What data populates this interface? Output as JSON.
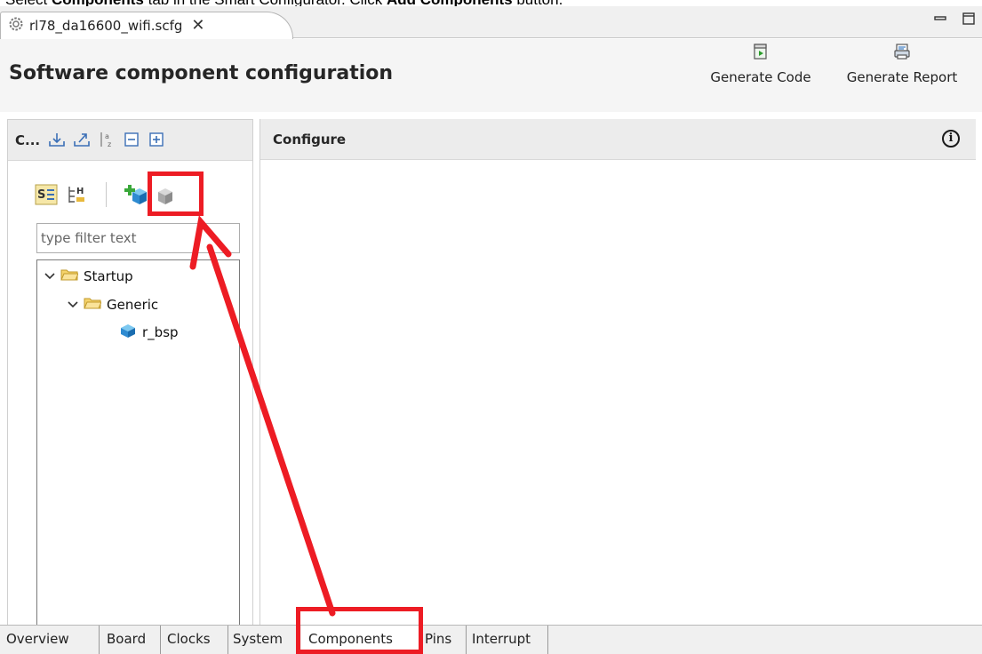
{
  "instruction": {
    "prefix": "Select ",
    "bold1": "Components",
    "mid": " tab in the Smart Configurator. Click ",
    "bold2": "Add Components",
    "suffix": " button."
  },
  "editor_tab": {
    "label": "rl78_da16600_wifi.scfg",
    "close": "✕"
  },
  "window_controls": {
    "minimize": "▭",
    "maximize": "☐"
  },
  "header": {
    "title": "Software component configuration",
    "generate_code": "Generate Code",
    "generate_report": "Generate Report"
  },
  "left_panel": {
    "title": "C...",
    "filter_placeholder": "type filter text",
    "tree": [
      {
        "label": "Startup",
        "icon": "folder-icon",
        "expanded": true
      },
      {
        "label": "Generic",
        "icon": "folder-icon",
        "expanded": true
      },
      {
        "label": "r_bsp",
        "icon": "component-icon"
      }
    ]
  },
  "right_panel": {
    "title": "Configure",
    "info": "i"
  },
  "bottom_tabs": [
    {
      "label": "Overview"
    },
    {
      "label": "Board"
    },
    {
      "label": "Clocks"
    },
    {
      "label": "System"
    },
    {
      "label": "Components",
      "active": true
    },
    {
      "label": "Pins"
    },
    {
      "label": "Interrupt"
    }
  ],
  "colors": {
    "annotation": "#ed1c24",
    "accent_blue": "#2e8bd1",
    "folder": "#e8b93c"
  }
}
